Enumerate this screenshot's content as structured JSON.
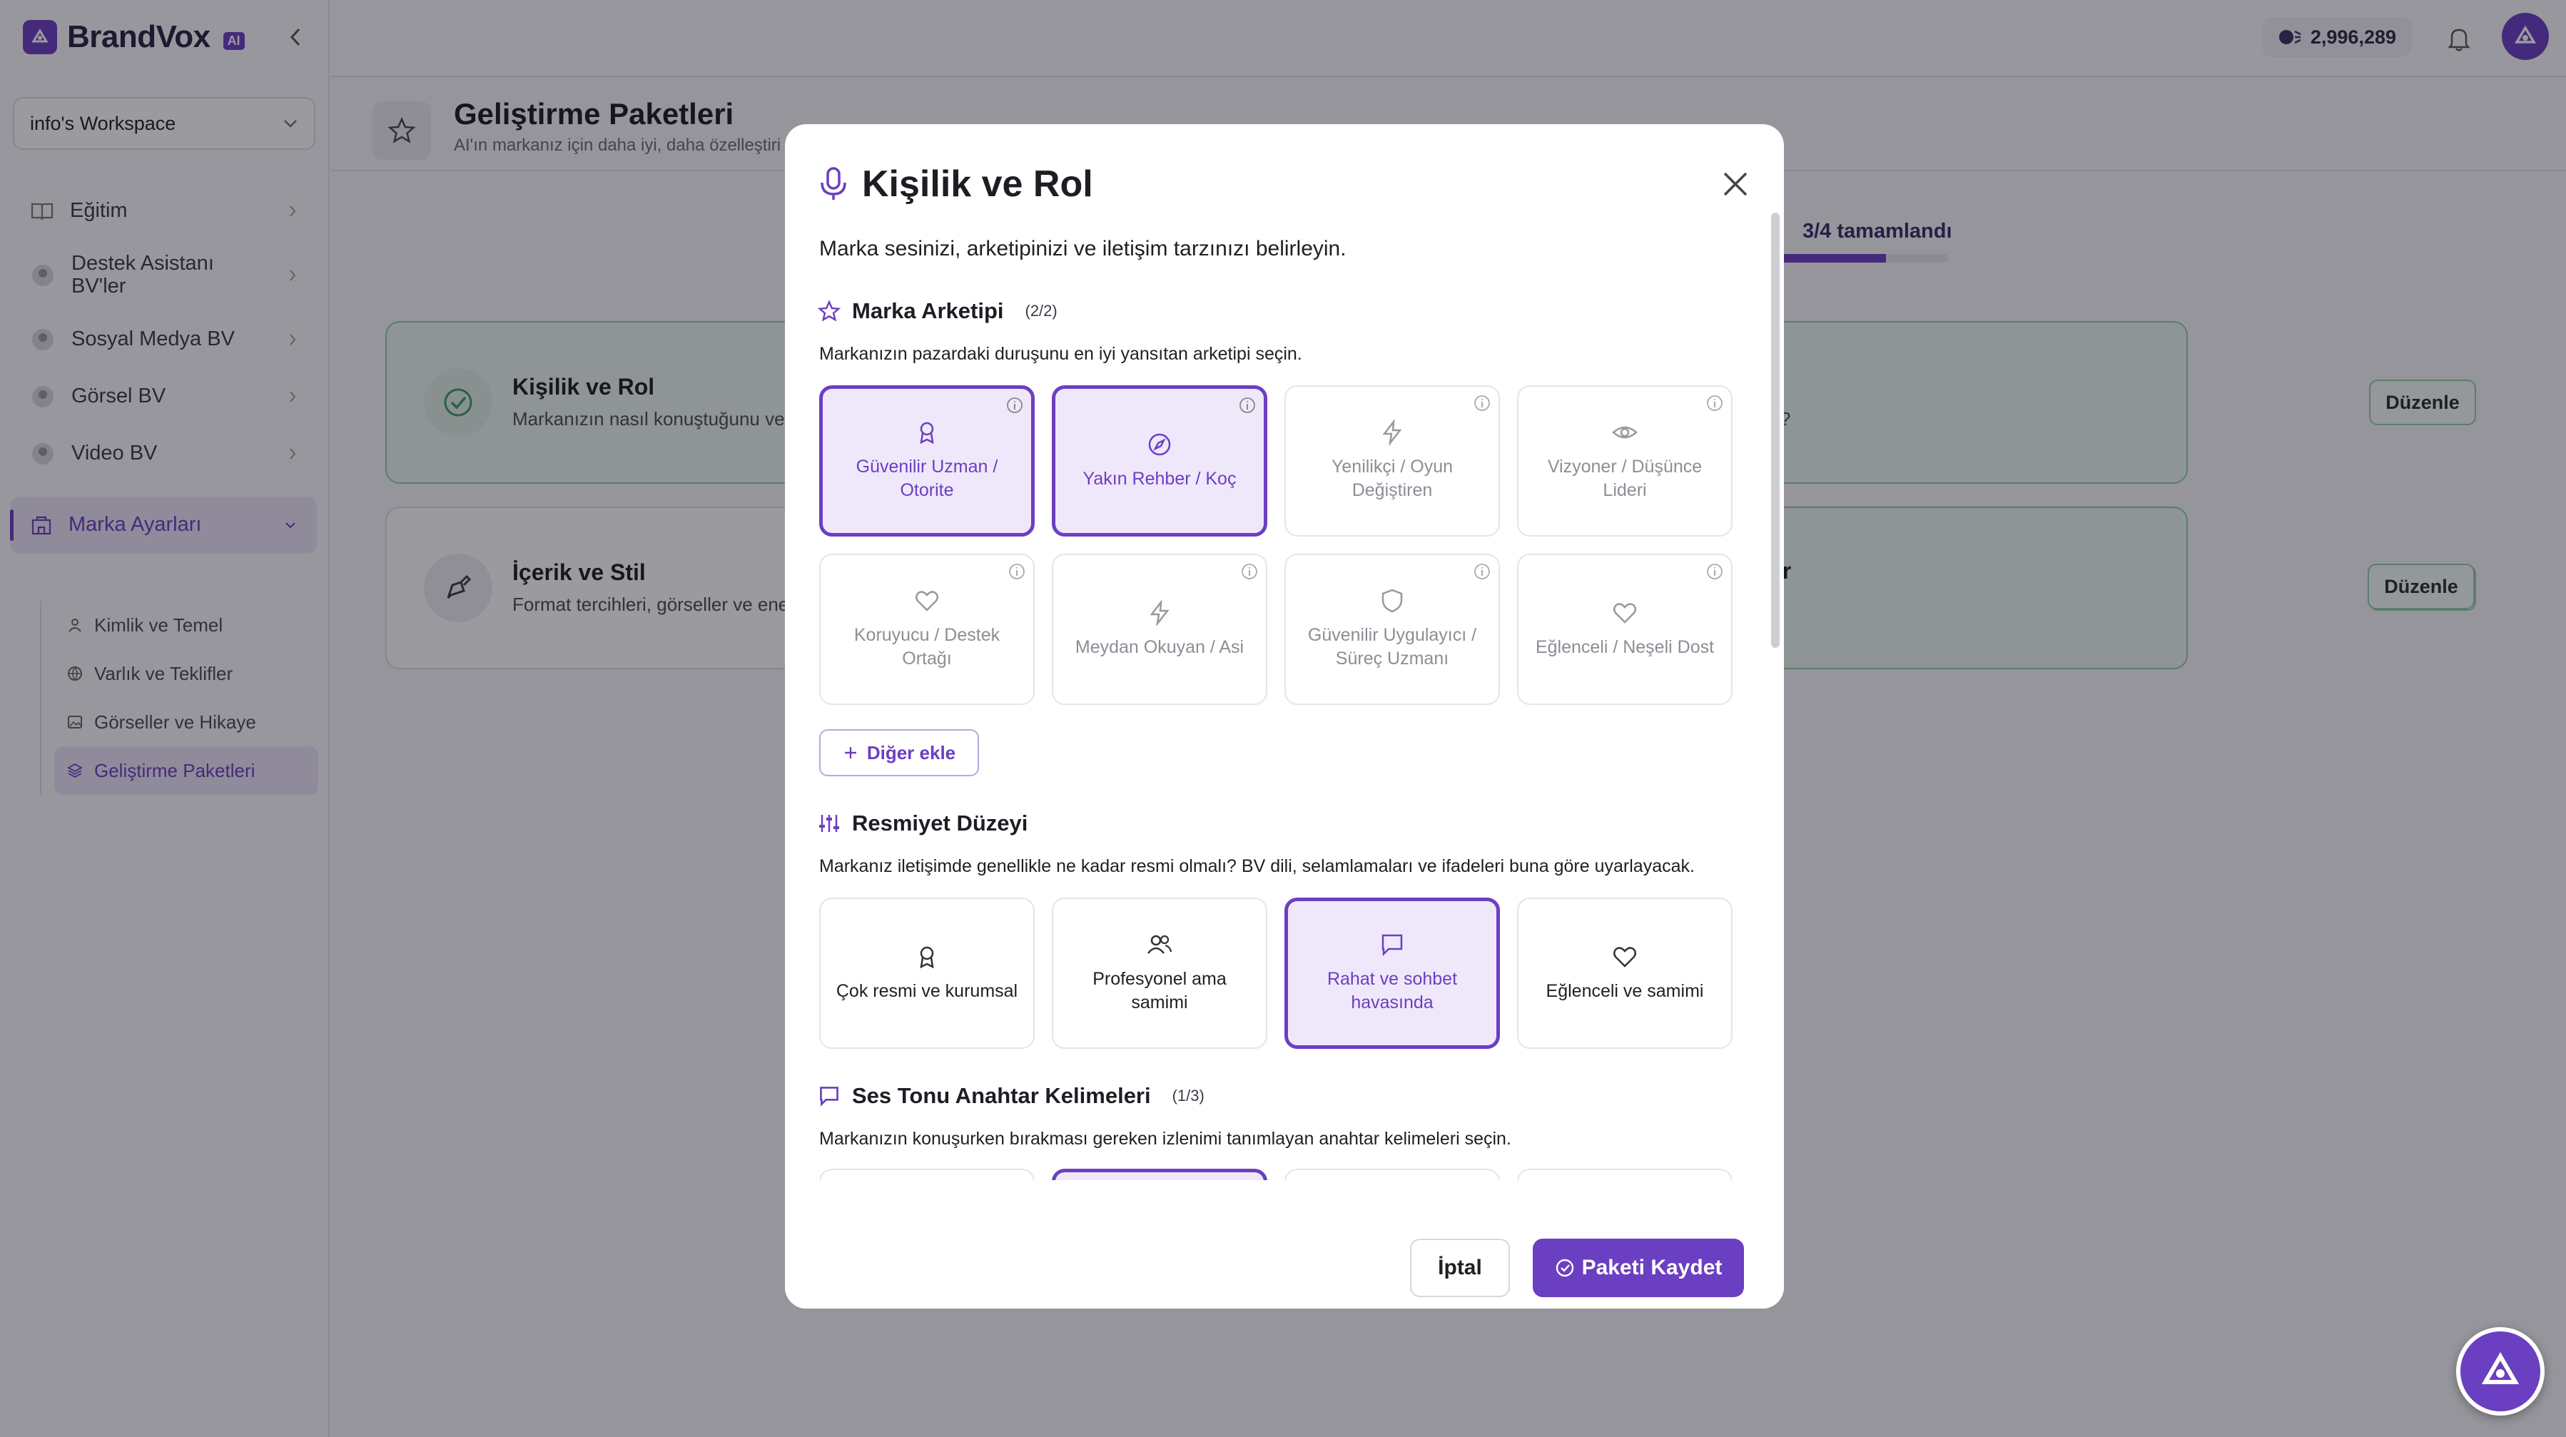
{
  "app": {
    "brand": "BrandVox",
    "brand_badge": "AI"
  },
  "workspace": {
    "name": "info's Workspace"
  },
  "credits": "2,996,289",
  "sidebar": {
    "items": [
      {
        "label": "Eğitim",
        "icon": "book-icon"
      },
      {
        "label": "Destek Asistanı BV'ler",
        "icon": "support-agent-icon"
      },
      {
        "label": "Sosyal Medya BV",
        "icon": "social-agent-icon"
      },
      {
        "label": "Görsel BV",
        "icon": "image-agent-icon"
      },
      {
        "label": "Video BV",
        "icon": "video-agent-icon"
      },
      {
        "label": "Marka Ayarları",
        "icon": "building-icon"
      }
    ],
    "subitems": [
      {
        "label": "Kimlik ve Temel",
        "icon": "user-icon"
      },
      {
        "label": "Varlık ve Teklifler",
        "icon": "globe-icon"
      },
      {
        "label": "Görseller ve Hikaye",
        "icon": "image-icon"
      },
      {
        "label": "Geliştirme Paketleri",
        "icon": "layers-icon"
      }
    ]
  },
  "page": {
    "title": "Geliştirme Paketleri",
    "subtitle": "AI'ın markanız için daha iyi, daha özelleştiri",
    "progress_text": "3/4 tamamlandı",
    "progress_fraction": 0.75
  },
  "cards": [
    {
      "title": "Kişilik ve Rol",
      "desc": "Markanızın nasıl konuştuğunu ve",
      "right_title": "r",
      "right_desc": "z?",
      "edit": "Düzenle"
    },
    {
      "title": "İçerik ve Stil",
      "desc": "Format tercihleri, görseller ve ene",
      "right_title": "ar",
      "right_desc": "?",
      "edit": "Düzenle"
    }
  ],
  "modal": {
    "title": "Kişilik ve Rol",
    "description": "Marka sesinizi, arketipinizi ve iletişim tarzınızı belirleyin.",
    "sections": {
      "archetype": {
        "title": "Marka Arketipi",
        "count": "(2/2)",
        "desc": "Markanızın pazardaki duruşunu en iyi yansıtan arketipi seçin.",
        "options": [
          {
            "label": "Güvenilir Uzman / Otorite",
            "icon": "award-icon",
            "selected": true
          },
          {
            "label": "Yakın Rehber / Koç",
            "icon": "compass-icon",
            "selected": true
          },
          {
            "label": "Yenilikçi / Oyun Değiştiren",
            "icon": "lightning-icon",
            "selected": false
          },
          {
            "label": "Vizyoner / Düşünce Lideri",
            "icon": "eye-icon",
            "selected": false
          },
          {
            "label": "Koruyucu / Destek Ortağı",
            "icon": "heart-icon",
            "selected": false
          },
          {
            "label": "Meydan Okuyan / Asi",
            "icon": "lightning-icon",
            "selected": false
          },
          {
            "label": "Güvenilir Uygulayıcı / Süreç Uzmanı",
            "icon": "shield-icon",
            "selected": false
          },
          {
            "label": "Eğlenceli / Neşeli Dost",
            "icon": "heart-icon",
            "selected": false
          }
        ],
        "add_other": "Diğer ekle"
      },
      "formality": {
        "title": "Resmiyet Düzeyi",
        "desc": "Markanız iletişimde genellikle ne kadar resmi olmalı? BV dili, selamlamaları ve ifadeleri buna göre uyarlayacak.",
        "options": [
          {
            "label": "Çok resmi ve kurumsal",
            "icon": "award-icon",
            "selected": false
          },
          {
            "label": "Profesyonel ama samimi",
            "icon": "users-icon",
            "selected": false
          },
          {
            "label": "Rahat ve sohbet havasında",
            "icon": "chat-icon",
            "selected": true
          },
          {
            "label": "Eğlenceli ve samimi",
            "icon": "heart-icon",
            "selected": false
          }
        ]
      },
      "tone": {
        "title": "Ses Tonu Anahtar Kelimeleri",
        "count": "(1/3)",
        "desc": "Markanızın konuşurken bırakması gereken izlenimi tanımlayan anahtar kelimeleri seçin."
      }
    },
    "cancel": "İptal",
    "save": "Paketi Kaydet"
  },
  "colors": {
    "accent": "#6b3fc1",
    "success_bg": "#eaf6ef",
    "success_border": "#8fcea6"
  }
}
